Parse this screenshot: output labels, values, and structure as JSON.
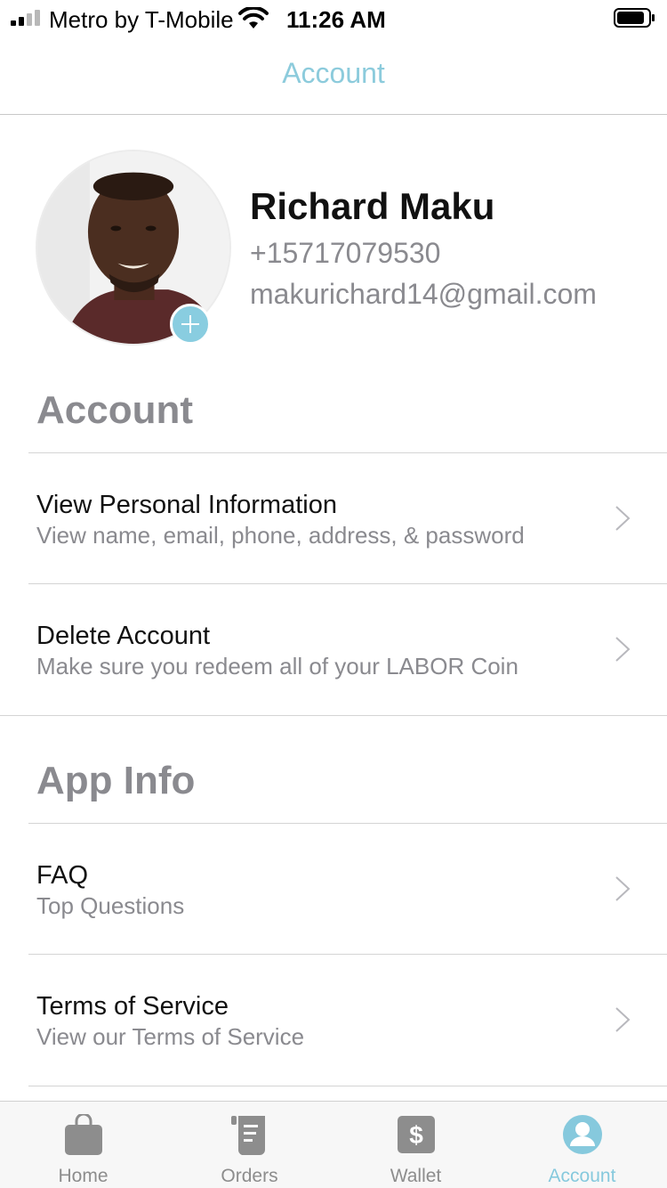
{
  "status_bar": {
    "carrier": "Metro by T-Mobile",
    "time": "11:26 AM"
  },
  "nav": {
    "title": "Account"
  },
  "profile": {
    "name": "Richard Maku",
    "phone": "+15717079530",
    "email": "makurichard14@gmail.com"
  },
  "sections": {
    "account": {
      "heading": "Account",
      "items": [
        {
          "title": "View Personal Information",
          "subtitle": "View name, email, phone, address, & password"
        },
        {
          "title": "Delete Account",
          "subtitle": "Make sure you redeem all of your LABOR Coin"
        }
      ]
    },
    "app_info": {
      "heading": "App Info",
      "items": [
        {
          "title": "FAQ",
          "subtitle": "Top Questions"
        },
        {
          "title": "Terms of Service",
          "subtitle": "View our Terms of Service"
        }
      ]
    }
  },
  "tab_bar": {
    "tabs": [
      {
        "label": "Home",
        "icon": "shopping-bag-icon"
      },
      {
        "label": "Orders",
        "icon": "receipt-scroll-icon"
      },
      {
        "label": "Wallet",
        "icon": "dollar-icon"
      },
      {
        "label": "Account",
        "icon": "person-icon"
      }
    ],
    "active": "Account"
  },
  "colors": {
    "accent": "#89cde0",
    "secondary_text": "#8a8a8f",
    "inactive_tab": "#8d8d8d"
  }
}
